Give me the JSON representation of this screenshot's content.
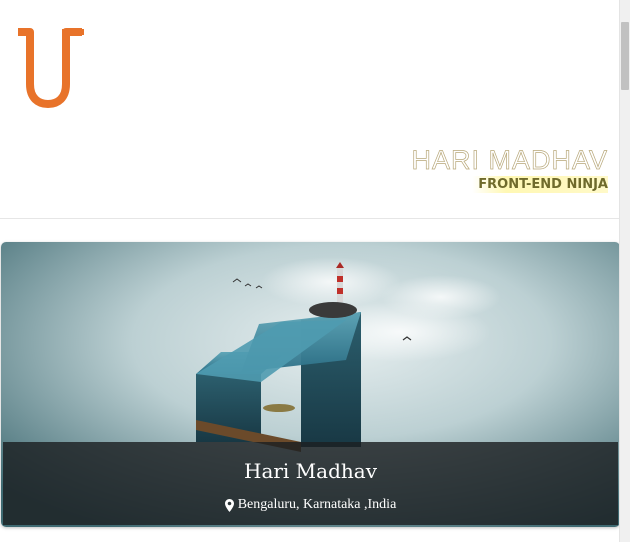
{
  "header": {
    "logo_letter": "U",
    "name": "HARI MADHAV",
    "tagline": "FRONT-END NINJA"
  },
  "profile_card": {
    "name": "Hari Madhav",
    "location": "Bengaluru, Karnataka ,India",
    "location_icon": "map-pin-icon"
  },
  "colors": {
    "logo_orange": "#e8732a",
    "tagline_text": "#6f6a2c",
    "tagline_highlight": "#fff8b4",
    "overlay_bg": "#1c2022"
  }
}
